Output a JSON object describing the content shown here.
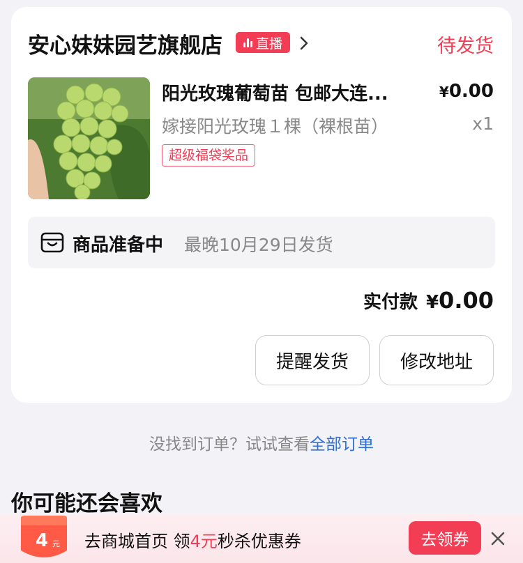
{
  "order": {
    "shop_name": "安心妹妹园艺旗舰店",
    "live_badge": "直播",
    "status": "待发货",
    "product": {
      "title": "阳光玫瑰葡萄苗 包邮大连...",
      "price_symbol": "¥",
      "price": "0.00",
      "spec": "嫁接阳光玫瑰１棵（裸根苗）",
      "quantity": "x1",
      "tag": "超级福袋奖品"
    },
    "shipping": {
      "title": "商品准备中",
      "date": "最晚10月29日发货"
    },
    "total": {
      "label": "实付款",
      "symbol": "¥",
      "amount": "0.00"
    },
    "buttons": {
      "remind": "提醒发货",
      "change_address": "修改地址"
    }
  },
  "not_found": {
    "text": "没找到订单？试试查看",
    "link": "全部订单"
  },
  "recommend": {
    "title": "你可能还会喜欢"
  },
  "coupon_bar": {
    "badge_value": "4",
    "badge_unit": "元",
    "text_prefix": "去商城首页 领",
    "text_highlight": "4元",
    "text_suffix": "秒杀优惠券",
    "button": "去领券"
  },
  "colors": {
    "accent": "#f23d54",
    "link": "#2f6fd6",
    "muted": "#888888"
  }
}
